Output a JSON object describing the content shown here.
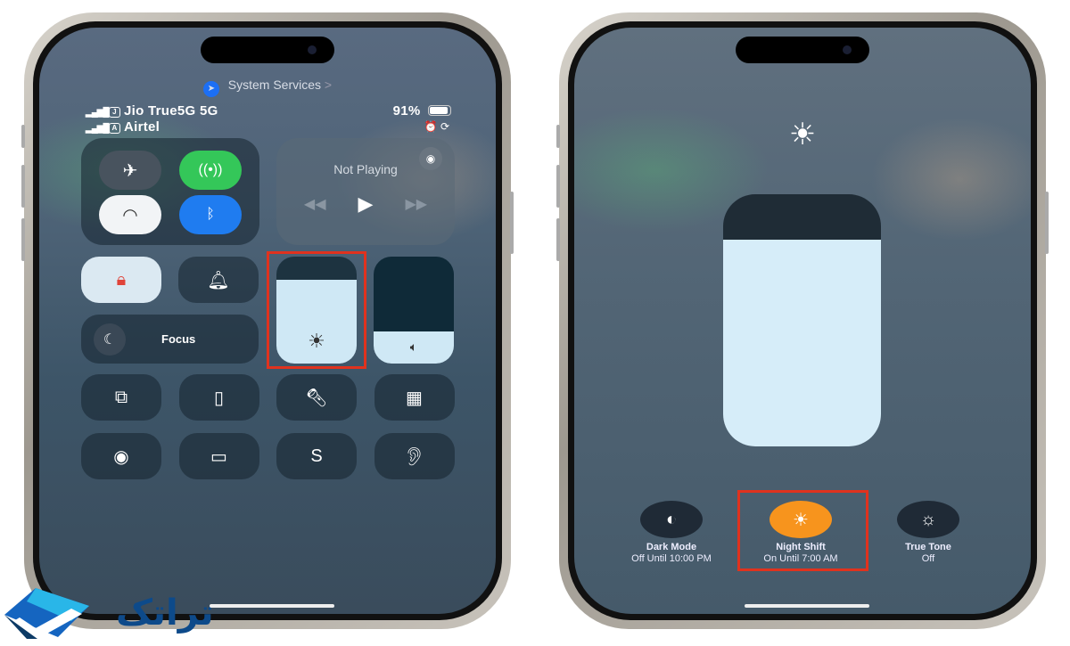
{
  "left_phone": {
    "location_indicator": {
      "label": "System Services",
      "icon": "location-arrow-icon",
      "chevron": ">"
    },
    "status": {
      "sim1": {
        "badge": "J",
        "carrier": "Jio True5G 5G"
      },
      "sim2": {
        "badge": "A",
        "carrier": "Airtel"
      },
      "battery_percent": "91%",
      "battery_level": 0.91
    },
    "connectivity": {
      "airplane": "off",
      "cellular": "on",
      "wifi": "on",
      "bluetooth": "on"
    },
    "media": {
      "status": "Not Playing",
      "airplay_icon": "airplay-icon"
    },
    "focus": {
      "label": "Focus"
    },
    "brightness_level": 0.78,
    "volume_level": 0.3,
    "tiles": [
      "screen-mirroring-icon",
      "remote-icon",
      "flashlight-icon",
      "calculator-icon",
      "screen-record-icon",
      "low-power-icon",
      "shazam-icon",
      "hearing-icon"
    ]
  },
  "right_phone": {
    "brightness_level": 0.82,
    "display_options": [
      {
        "title": "Dark Mode",
        "subtitle": "Off Until 10:00 PM",
        "icon": "dark-mode-icon",
        "color": "#1f2a36"
      },
      {
        "title": "Night Shift",
        "subtitle": "On Until 7:00 AM",
        "icon": "night-shift-icon",
        "color": "#f7941d"
      },
      {
        "title": "True Tone",
        "subtitle": "Off",
        "icon": "true-tone-icon",
        "color": "#1f2a36"
      }
    ]
  },
  "highlight_color": "#e0321e",
  "logo": {
    "text": "تراتک",
    "colors": [
      "#1565c0",
      "#29b6e8",
      "#0d3b66"
    ]
  }
}
